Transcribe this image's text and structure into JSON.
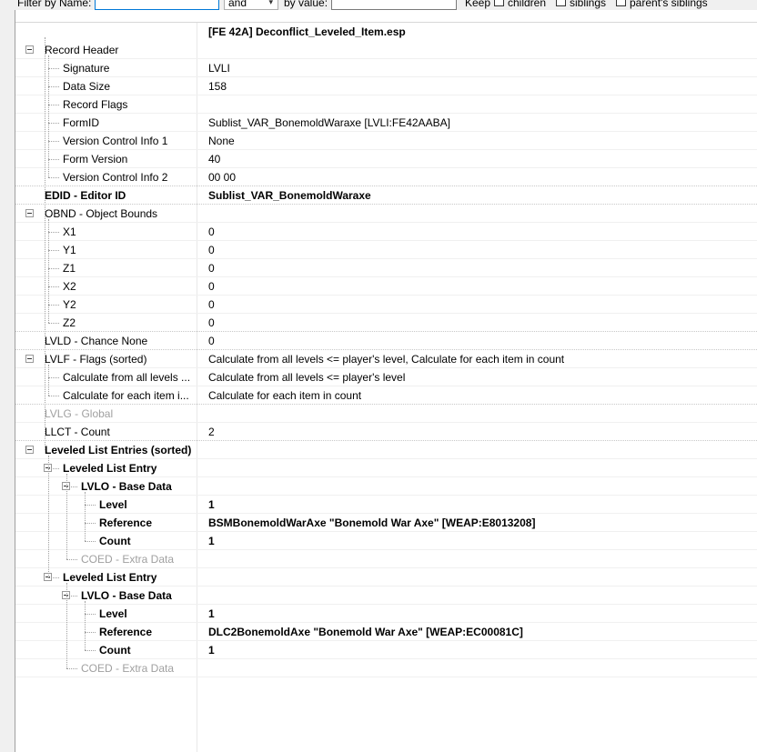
{
  "filterbar": {
    "filter_name_label": "Filter by Name:",
    "combo_value": "and",
    "by_value_label": "by value:",
    "keep_label": "Keep",
    "children_label": "children",
    "siblings_label": "siblings",
    "parents_siblings_label": "parent's siblings"
  },
  "header": {
    "file": "[FE 42A] Deconflict_Leveled_Item.esp"
  },
  "rows": [
    {
      "name": "Record Header",
      "value": ""
    },
    {
      "name": "Signature",
      "value": "LVLI"
    },
    {
      "name": "Data Size",
      "value": "158"
    },
    {
      "name": "Record Flags",
      "value": ""
    },
    {
      "name": "FormID",
      "value": "Sublist_VAR_BonemoldWaraxe [LVLI:FE42AABA]"
    },
    {
      "name": "Version Control Info 1",
      "value": "None"
    },
    {
      "name": "Form Version",
      "value": "40"
    },
    {
      "name": "Version Control Info 2",
      "value": "00 00"
    },
    {
      "name": "EDID - Editor ID",
      "value": "Sublist_VAR_BonemoldWaraxe"
    },
    {
      "name": "OBND - Object Bounds",
      "value": ""
    },
    {
      "name": "X1",
      "value": "0"
    },
    {
      "name": "Y1",
      "value": "0"
    },
    {
      "name": "Z1",
      "value": "0"
    },
    {
      "name": "X2",
      "value": "0"
    },
    {
      "name": "Y2",
      "value": "0"
    },
    {
      "name": "Z2",
      "value": "0"
    },
    {
      "name": "LVLD - Chance None",
      "value": "0"
    },
    {
      "name": "LVLF - Flags (sorted)",
      "value": "Calculate from all levels <= player's level, Calculate for each item in count"
    },
    {
      "name": "Calculate from all levels ...",
      "value": "Calculate from all levels <= player's level"
    },
    {
      "name": "Calculate for each item i...",
      "value": "Calculate for each item in count"
    },
    {
      "name": "LVLG - Global",
      "value": ""
    },
    {
      "name": "LLCT - Count",
      "value": "2"
    },
    {
      "name": "Leveled List Entries (sorted)",
      "value": ""
    },
    {
      "name": "Leveled List Entry",
      "value": ""
    },
    {
      "name": "LVLO - Base Data",
      "value": ""
    },
    {
      "name": "Level",
      "value": "1"
    },
    {
      "name": "Reference",
      "value": "BSMBonemoldWarAxe \"Bonemold War Axe\" [WEAP:E8013208]"
    },
    {
      "name": "Count",
      "value": "1"
    },
    {
      "name": "COED - Extra Data",
      "value": ""
    },
    {
      "name": "Leveled List Entry",
      "value": ""
    },
    {
      "name": "LVLO - Base Data",
      "value": ""
    },
    {
      "name": "Level",
      "value": "1"
    },
    {
      "name": "Reference",
      "value": "DLC2BonemoldAxe \"Bonemold War Axe\" [WEAP:EC00081C]"
    },
    {
      "name": "Count",
      "value": "1"
    },
    {
      "name": "COED - Extra Data",
      "value": ""
    }
  ]
}
